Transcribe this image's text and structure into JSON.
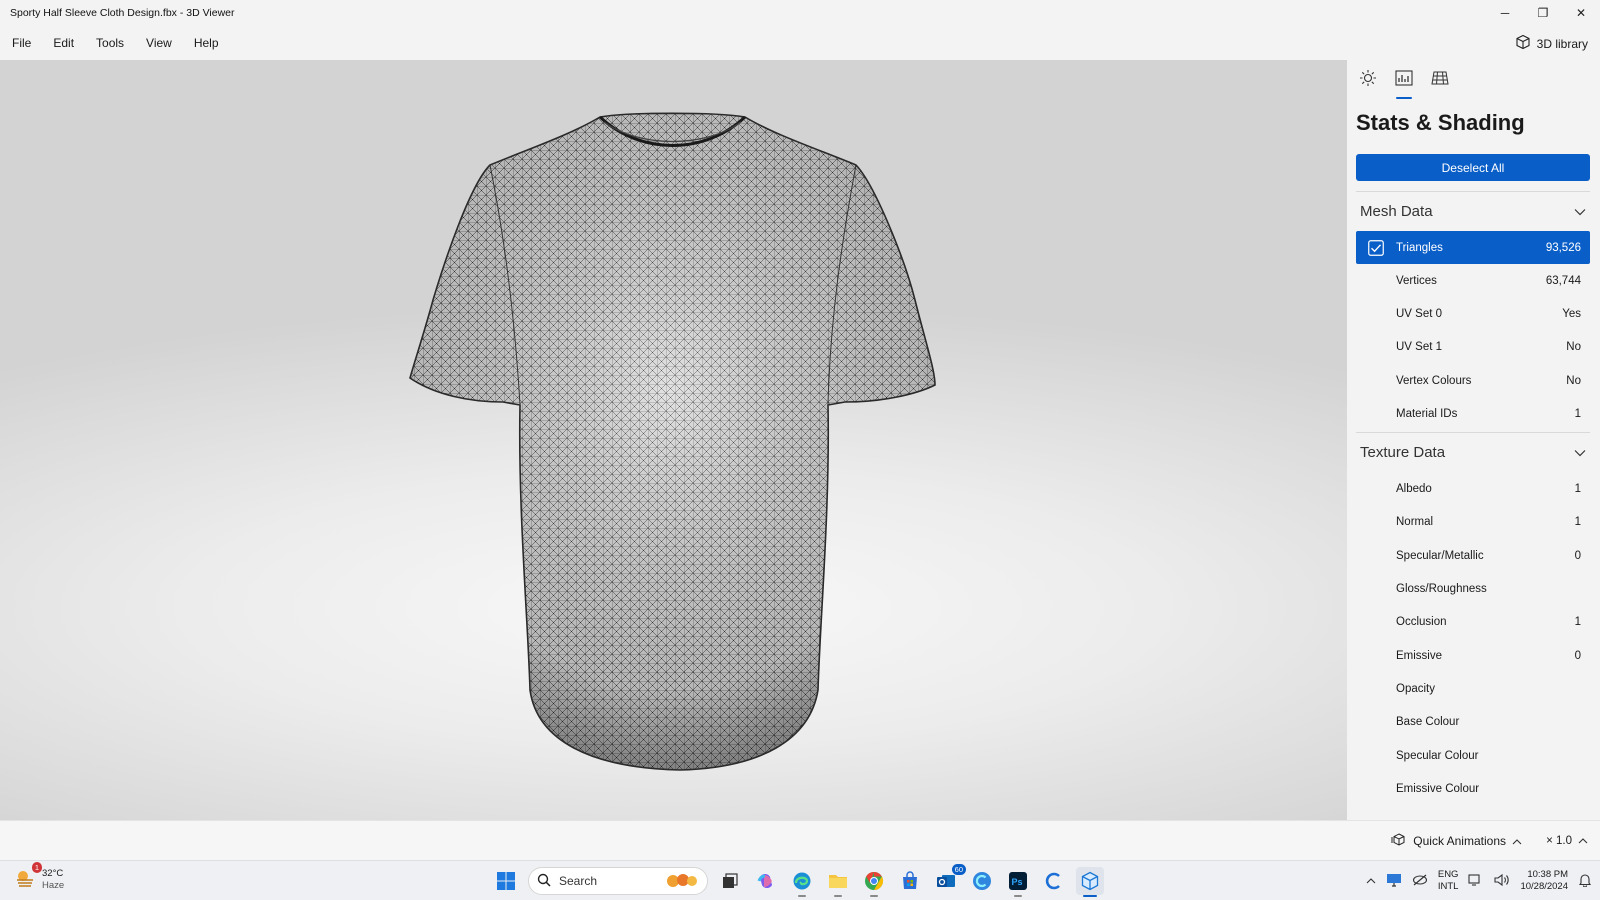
{
  "window": {
    "title": "Sporty Half Sleeve Cloth Design.fbx - 3D Viewer",
    "minimize": "─",
    "restore": "❐",
    "close": "✕"
  },
  "menu": {
    "items": [
      "File",
      "Edit",
      "Tools",
      "View",
      "Help"
    ],
    "library_label": "3D library"
  },
  "panel": {
    "title": "Stats & Shading",
    "deselect_label": "Deselect All",
    "mesh_section": "Mesh Data",
    "mesh_rows": [
      {
        "label": "Triangles",
        "value": "93,526",
        "selected": true
      },
      {
        "label": "Vertices",
        "value": "63,744"
      },
      {
        "label": "UV Set 0",
        "value": "Yes"
      },
      {
        "label": "UV Set 1",
        "value": "No"
      },
      {
        "label": "Vertex Colours",
        "value": "No"
      },
      {
        "label": "Material IDs",
        "value": "1"
      }
    ],
    "texture_section": "Texture Data",
    "texture_rows": [
      {
        "label": "Albedo",
        "value": "1"
      },
      {
        "label": "Normal",
        "value": "1"
      },
      {
        "label": "Specular/Metallic",
        "value": "0"
      },
      {
        "label": "Gloss/Roughness",
        "value": ""
      },
      {
        "label": "Occlusion",
        "value": "1"
      },
      {
        "label": "Emissive",
        "value": "0"
      },
      {
        "label": "Opacity",
        "value": ""
      },
      {
        "label": "Base Colour",
        "value": ""
      },
      {
        "label": "Specular Colour",
        "value": ""
      },
      {
        "label": "Emissive Colour",
        "value": ""
      }
    ]
  },
  "bottom": {
    "quick_animations": "Quick Animations",
    "speed": "× 1.0"
  },
  "taskbar": {
    "weather_temp": "32°C",
    "weather_cond": "Haze",
    "weather_badge": "1",
    "search_placeholder": "Search",
    "mail_badge": "60",
    "lang_top": "ENG",
    "lang_bottom": "INTL",
    "time": "10:38 PM",
    "date": "10/28/2024"
  },
  "colors": {
    "accent": "#0a5ec7",
    "panel_bg": "#f3f3f3"
  }
}
